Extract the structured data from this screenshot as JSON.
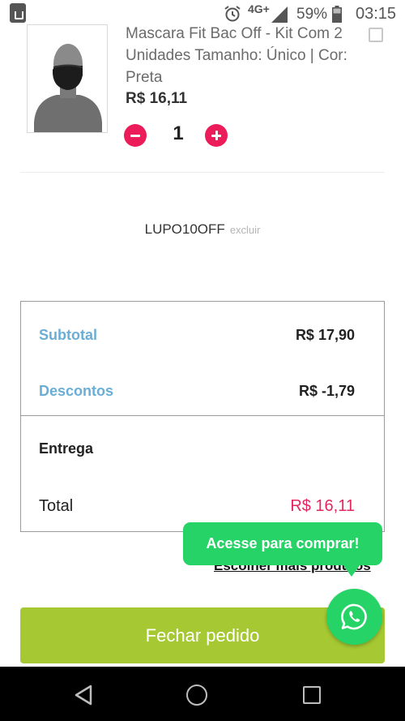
{
  "status_bar": {
    "network": "4G+",
    "battery_percent": "59%",
    "time": "03:15"
  },
  "product": {
    "title": "Mascara Fit Bac Off - Kit Com 2 Unidades Tamanho: Único | Cor: Preta",
    "price": "R$ 16,11",
    "quantity": "1"
  },
  "coupon": {
    "code": "LUPO10OFF",
    "remove_label": "excluir"
  },
  "summary": {
    "subtotal_label": "Subtotal",
    "subtotal_value": "R$ 17,90",
    "discounts_label": "Descontos",
    "discounts_value": "R$ -1,79",
    "shipping_label": "Entrega",
    "total_label": "Total",
    "total_value": "R$ 16,11"
  },
  "more_products_link": "Escolher mais produtos",
  "whatsapp": {
    "tooltip": "Acesse para comprar!",
    "icon": "whatsapp-icon"
  },
  "checkout_button": "Fechar pedido",
  "colors": {
    "accent_pink": "#ec1c5b",
    "total_red": "#e5265f",
    "label_blue": "#6aaed6",
    "checkout_green": "#a6c832",
    "whatsapp_green": "#25d366"
  }
}
